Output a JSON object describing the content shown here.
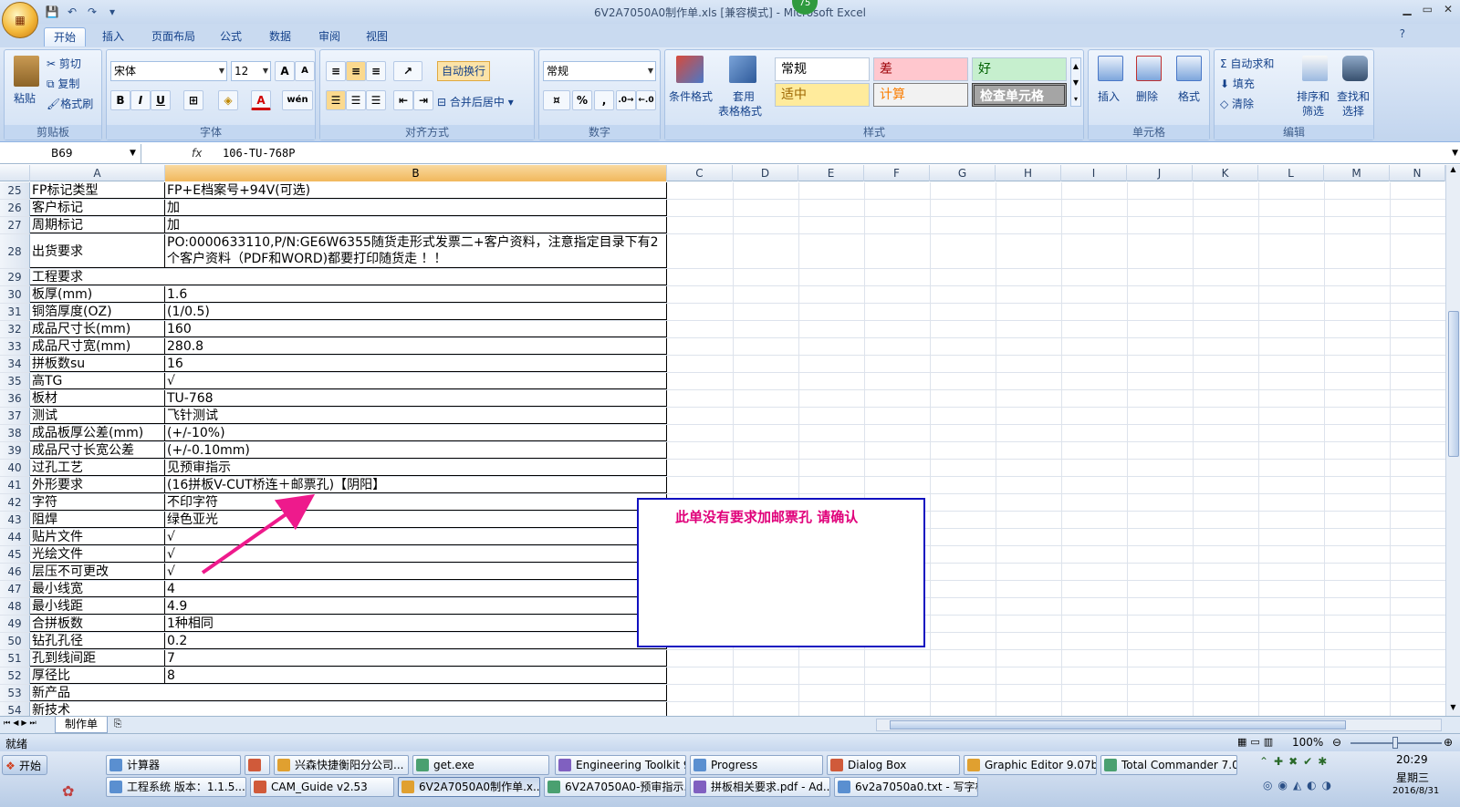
{
  "app": {
    "title": "6V2A7050A0制作单.xls  [兼容模式] - Microsoft Excel",
    "orb_label": "Office",
    "notification_count": "75"
  },
  "ribbon_tabs": [
    "开始",
    "插入",
    "页面布局",
    "公式",
    "数据",
    "审阅",
    "视图"
  ],
  "clipboard": {
    "paste": "粘贴",
    "cut": "剪切",
    "copy": "复制",
    "format_painter": "格式刷",
    "label": "剪贴板"
  },
  "font": {
    "name": "宋体",
    "size": "12",
    "label": "字体",
    "bold": "B",
    "italic": "I",
    "underline": "U",
    "grow": "A",
    "shrink": "A",
    "color_a": "A",
    "phonetic": "wén"
  },
  "alignment": {
    "wrap": "自动换行",
    "merge": "合并后居中",
    "label": "对齐方式"
  },
  "number": {
    "format": "常规",
    "percent": "%",
    "comma": ",",
    "label": "数字"
  },
  "styles": {
    "conditional": "条件格式",
    "table_fmt_1": "套用",
    "table_fmt_2": "表格格式",
    "normal": "常规",
    "bad": "差",
    "good": "好",
    "neutral": "适中",
    "calc": "计算",
    "check": "检查单元格",
    "label": "样式"
  },
  "cells_group": {
    "insert": "插入",
    "delete": "删除",
    "format": "格式",
    "label": "单元格"
  },
  "editing": {
    "autosum": "自动求和",
    "fill": "填充",
    "clear": "清除",
    "sort_1": "排序和",
    "sort_2": "筛选",
    "find_1": "查找和",
    "find_2": "选择",
    "label": "编辑"
  },
  "formula_bar": {
    "name_box": "B69",
    "fx": "fx",
    "content": "106-TU-768P"
  },
  "columns": [
    "A",
    "B",
    "C",
    "D",
    "E",
    "F",
    "G",
    "H",
    "I",
    "J",
    "K",
    "L",
    "M",
    "N"
  ],
  "rows": [
    {
      "n": "25",
      "a": "FP标记类型",
      "b": "FP+E档案号+94V(可选)"
    },
    {
      "n": "26",
      "a": "客户标记",
      "b": "加"
    },
    {
      "n": "27",
      "a": "周期标记",
      "b": "加"
    },
    {
      "n": "28",
      "a": "出货要求",
      "b": "PO:0000633110,P/N:GE6W6355随货走形式发票二+客户资料，注意指定目录下有2个客户资料（PDF和WORD)都要打印随货走 ！！"
    },
    {
      "n": "29",
      "a": "工程要求",
      "b": ""
    },
    {
      "n": "30",
      "a": "板厚(mm)",
      "b": "1.6"
    },
    {
      "n": "31",
      "a": "铜箔厚度(OZ)",
      "b": " (1/0.5)"
    },
    {
      "n": "32",
      "a": "成品尺寸长(mm)",
      "b": "160"
    },
    {
      "n": "33",
      "a": "成品尺寸宽(mm)",
      "b": "280.8"
    },
    {
      "n": "34",
      "a": "拼板数su",
      "b": "16"
    },
    {
      "n": "35",
      "a": "高TG",
      "b": "√"
    },
    {
      "n": "36",
      "a": "板材",
      "b": "TU-768"
    },
    {
      "n": "37",
      "a": "测试",
      "b": "飞针测试"
    },
    {
      "n": "38",
      "a": "成品板厚公差(mm)",
      "b": "(+/-10%)"
    },
    {
      "n": "39",
      "a": "成品尺寸长宽公差",
      "b": "(+/-0.10mm)"
    },
    {
      "n": "40",
      "a": "过孔工艺",
      "b": "见预审指示"
    },
    {
      "n": "41",
      "a": "外形要求",
      "b": "(16拼板V-CUT桥连＋邮票孔)【阴阳】"
    },
    {
      "n": "42",
      "a": "字符",
      "b": "不印字符"
    },
    {
      "n": "43",
      "a": "阻焊",
      "b": "绿色亚光"
    },
    {
      "n": "44",
      "a": "贴片文件",
      "b": "√"
    },
    {
      "n": "45",
      "a": "光绘文件",
      "b": "√"
    },
    {
      "n": "46",
      "a": "层压不可更改",
      "b": "√"
    },
    {
      "n": "47",
      "a": "最小线宽",
      "b": "4"
    },
    {
      "n": "48",
      "a": "最小线距",
      "b": "4.9"
    },
    {
      "n": "49",
      "a": "合拼板数",
      "b": "1种相同"
    },
    {
      "n": "50",
      "a": "钻孔孔径",
      "b": "0.2"
    },
    {
      "n": "51",
      "a": "孔到线间距",
      "b": "7"
    },
    {
      "n": "52",
      "a": "厚径比",
      "b": "8"
    },
    {
      "n": "53",
      "a": "新产品",
      "b": ""
    },
    {
      "n": "54",
      "a": "新技术",
      "b": ""
    }
  ],
  "annotation": {
    "text": "此单没有要求加邮票孔 请确认",
    "color": "#e0007a",
    "border_color": "#1010c0"
  },
  "sheet_tab": "制作单",
  "statusbar": {
    "ready": "就绪",
    "zoom": "100%"
  },
  "taskbar": {
    "start": "开始",
    "row1": [
      "计算器",
      "",
      "兴森快捷衡阳分公司...",
      "get.exe",
      "Engineering Toolkit 9.0...",
      "Progress",
      "Dialog Box",
      "Graphic Editor 9.07b2 ...",
      "Total Commander 7.0 ..."
    ],
    "row2": [
      "工程系统 版本：1.1.5...",
      "CAM_Guide v2.53",
      "6V2A7050A0制作单.x...",
      "6V2A7050A0-预审指示...",
      "拼板相关要求.pdf - Ad...",
      "6v2a7050a0.txt - 写字板"
    ],
    "time": "20:29",
    "weekday": "星期三",
    "date": "2016/8/31"
  }
}
